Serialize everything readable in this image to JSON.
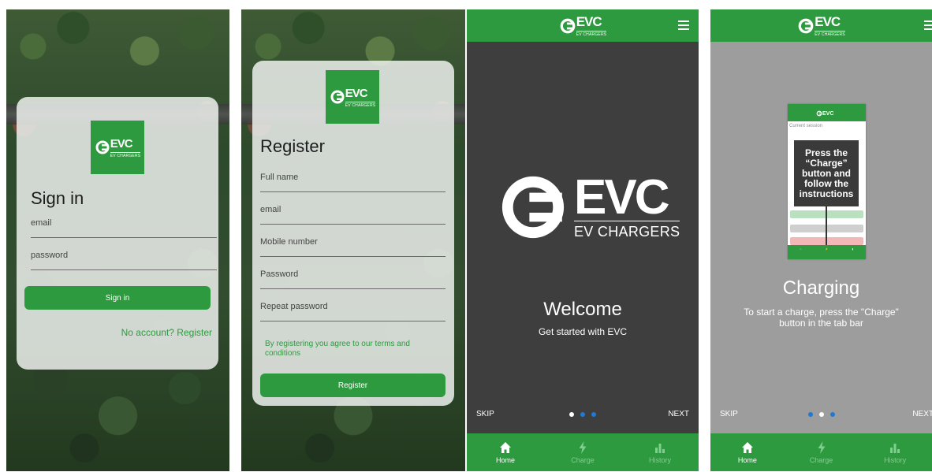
{
  "brand": {
    "name": "EVC",
    "subtitle": "EV CHARGERS",
    "green": "#2e9a3f"
  },
  "signin": {
    "title": "Sign in",
    "email_placeholder": "email",
    "password_placeholder": "password",
    "button": "Sign in",
    "register_link": "No account? Register"
  },
  "register": {
    "title": "Register",
    "fields": [
      "Full name",
      "email",
      "Mobile number",
      "Password",
      "Repeat password"
    ],
    "terms": "By registering you agree to our terms and conditions",
    "button": "Register"
  },
  "welcome": {
    "heading": "Welcome",
    "subheading": "Get started with EVC",
    "skip": "SKIP",
    "next": "NEXT"
  },
  "charging": {
    "heading": "Charging",
    "description": "To start a charge, press the \"Charge\" button in the tab bar",
    "tooltip": "Press the “Charge” button and follow the instructions",
    "mock_session": "Current session",
    "skip": "SKIP",
    "next": "NEXT"
  },
  "tabs": [
    {
      "label": "Home",
      "icon": "home-icon"
    },
    {
      "label": "Charge",
      "icon": "bolt-icon"
    },
    {
      "label": "History",
      "icon": "bar-chart-icon"
    }
  ]
}
